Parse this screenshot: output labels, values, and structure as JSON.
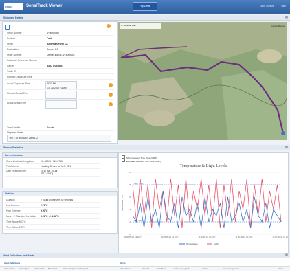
{
  "app": {
    "logo": "ZONEX",
    "title": "SensiTrack Viewer",
    "center_button": "Trip Detail",
    "user": "Alert Console",
    "sign": "Help"
  },
  "sections": {
    "shipment": "Shipment Details",
    "sensor": "Sensor Statistics",
    "alerts": "Alert Definitions and Alerts"
  },
  "shipment": {
    "rows": [
      {
        "k": "Serial Number",
        "v": "SV4000089"
      },
      {
        "k": "Product",
        "v": "Fruit",
        "bold": true
      },
      {
        "k": "Origin",
        "v": "Alderman Farm CA",
        "bold": true
      },
      {
        "k": "Destination",
        "v": "Denver CO"
      },
      {
        "k": "Order Number",
        "v": "Denver,WAGE-SV4000001"
      },
      {
        "k": "Customer Reference Number",
        "v": ""
      },
      {
        "k": "Carrier",
        "v": "ABC Trucking",
        "bold": true
      },
      {
        "k": "Trailer ID",
        "v": ""
      },
      {
        "k": "Planned Departure Time",
        "v": ""
      }
    ],
    "tall_rows": [
      {
        "k": "Actual Departure Time",
        "v1": "9:32 AM",
        "v2": "10 Jul 2017 (GMT)"
      },
      {
        "k": "Planned Arrival Time",
        "v1": "",
        "v2": ""
      },
      {
        "k": "Actual Arrival Time",
        "v1": "",
        "v2": ""
      }
    ],
    "profile": {
      "k": "Trend Profile",
      "v": "Private"
    },
    "comments_label": "Shipment Notes",
    "comments": "Trip 1: to test case 25691. 2"
  },
  "map_tools": "+ - Satellite Map",
  "map_label": "Carson Range",
  "location": {
    "title": "Current Location",
    "rows": [
      {
        "k": "Current Latitude Longitude",
        "v": "-11.00000 - 113.0715"
      },
      {
        "k": "Full Address",
        "v": "Heading Denver on U.S. 95N"
      },
      {
        "k": "Date Reading Time",
        "v": "10:17 AM 10 Jul 2017 (GMT)"
      }
    ]
  },
  "stats": {
    "title": "Statistics",
    "rows": [
      {
        "k": "Duration",
        "v": "2 hours 20 minutes 42 seconds"
      },
      {
        "k": "Low Extreme",
        "v": "2.72°C"
      },
      {
        "k": "High Extreme",
        "v": "9.90°C"
      },
      {
        "k": "Mean +/- Standard Deviation",
        "v": "3.22°C +/- 1.32°C"
      },
      {
        "k": "Time Above 8°C %",
        "v": ""
      },
      {
        "k": "Time Below 2°C %",
        "v": ""
      }
    ]
  },
  "chart_opts": [
    "Show Location Time Zone (GMT)",
    "Estimated Location Time Zone (GMT)"
  ],
  "chart_data": {
    "type": "line",
    "title": "Temperature & Light Levels",
    "ylabel": "Temperature (°C)",
    "ylim": [
      0,
      10
    ],
    "x": [
      "10:00 AM 10 Jul 2017",
      "10:30 AM 10 Jul 2017",
      "11:00 AM 10 Jul 2017",
      "11:30 AM 10 Jul 2017",
      "12:00 PM 10 Jul 2017"
    ],
    "series": [
      {
        "name": "Temperature",
        "color": "#3a78c9",
        "values": [
          3,
          2,
          5,
          1,
          6,
          2,
          4,
          1,
          7,
          3,
          2,
          5,
          1,
          6,
          3,
          4,
          2,
          5,
          1,
          6,
          2,
          4,
          3,
          5,
          1,
          6,
          2,
          3,
          5,
          2,
          4,
          1,
          6,
          3,
          2,
          5,
          1,
          4,
          3,
          2
        ]
      },
      {
        "name": "Light",
        "color": "#e8546a",
        "values": [
          8,
          2,
          9,
          3,
          8,
          1,
          9,
          4,
          7,
          2,
          9,
          3,
          8,
          1,
          9,
          2,
          7,
          4,
          9,
          3,
          8,
          2,
          9,
          1,
          8,
          3,
          9,
          2,
          7,
          4,
          9,
          1,
          8,
          3,
          9,
          2,
          7,
          4,
          8,
          2
        ]
      }
    ],
    "thresholds": [
      {
        "label": "High Temp",
        "value": 8
      },
      {
        "label": "Low Temp",
        "value": 2
      }
    ],
    "grid": true,
    "legend": "bottom"
  },
  "alerts": {
    "defs_title": "Alert Definitions",
    "alerts_title": "Alerts",
    "defs_cols": [
      "Alarm Name",
      "Alarm Type",
      "Alarm Limit",
      "Threshold",
      "Acknowledgement Required"
    ],
    "alerts_cols": [
      "Alarm Name",
      "Alarm ID",
      "Date/Time",
      "Latitude, Longitude",
      "Location",
      "Acknowledgement",
      "Status"
    ]
  }
}
